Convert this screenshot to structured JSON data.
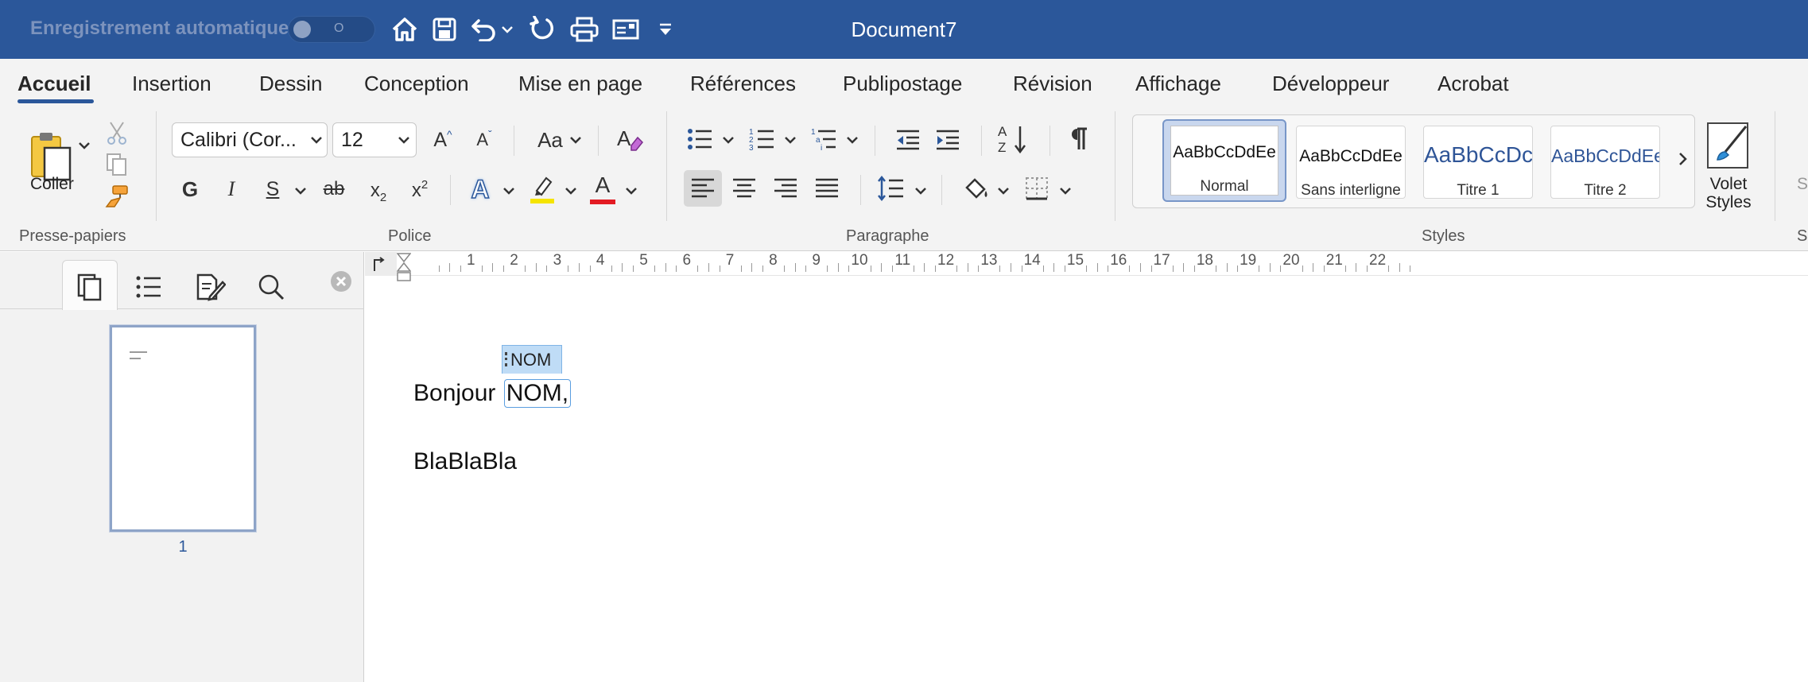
{
  "titlebar": {
    "autosave_label": "Enregistrement automatique",
    "autosave_state": "O",
    "document_title": "Document7",
    "bg_color": "#2b579a",
    "qat_icons": [
      "home-icon",
      "save-icon",
      "undo-icon",
      "chevron-down-icon",
      "redo-icon",
      "print-icon",
      "email-icon",
      "customize-toolbar-icon"
    ]
  },
  "tabs": [
    "Accueil",
    "Insertion",
    "Dessin",
    "Conception",
    "Mise en page",
    "Références",
    "Publipostage",
    "Révision",
    "Affichage",
    "Développeur",
    "Acrobat"
  ],
  "active_tab": "Accueil",
  "clipboard": {
    "paste_label": "Coller",
    "group_label": "Presse-papiers"
  },
  "font": {
    "font_name": "Calibri (Cor...",
    "font_size": "12",
    "bold": "G",
    "italic": "I",
    "underline": "S",
    "strikethrough": "ab",
    "subscript": "x",
    "subscript_sub": "2",
    "superscript": "x",
    "superscript_sup": "2",
    "change_case": "Aa",
    "grow": "A",
    "shrink": "A",
    "text_effects": "A",
    "font_color": "A",
    "font_color_value": "#e31b23",
    "highlight_color_value": "#f5e400",
    "group_label": "Police"
  },
  "paragraph": {
    "group_label": "Paragraphe",
    "sort_label_top": "A",
    "sort_label_bottom": "Z"
  },
  "styles": {
    "group_label": "Styles",
    "items": [
      {
        "sample": "AaBbCcDdEe",
        "name": "Normal",
        "selected": true
      },
      {
        "sample": "AaBbCcDdEe",
        "name": "Sans interligne",
        "selected": false
      },
      {
        "sample": "AaBbCcDc",
        "name": "Titre 1",
        "selected": false
      },
      {
        "sample": "AaBbCcDdEe",
        "name": "Titre 2",
        "selected": false
      }
    ],
    "pane_label_line1": "Volet",
    "pane_label_line2": "Styles",
    "next_group_cut": "S"
  },
  "navpane": {
    "tabs": [
      "pages-icon",
      "headings-icon",
      "edit-icon",
      "search-icon"
    ],
    "page_number": "1"
  },
  "ruler": {
    "numbers": [
      "1",
      "2",
      "3",
      "4",
      "5",
      "6",
      "7",
      "8",
      "9",
      "10",
      "11",
      "12",
      "13",
      "14",
      "15",
      "16",
      "17",
      "18",
      "19",
      "20",
      "21",
      "22"
    ]
  },
  "document": {
    "field_tag": "NOM",
    "line1_before": "Bonjour",
    "line1_field": "NOM,",
    "line2": "BlaBlaBla"
  }
}
